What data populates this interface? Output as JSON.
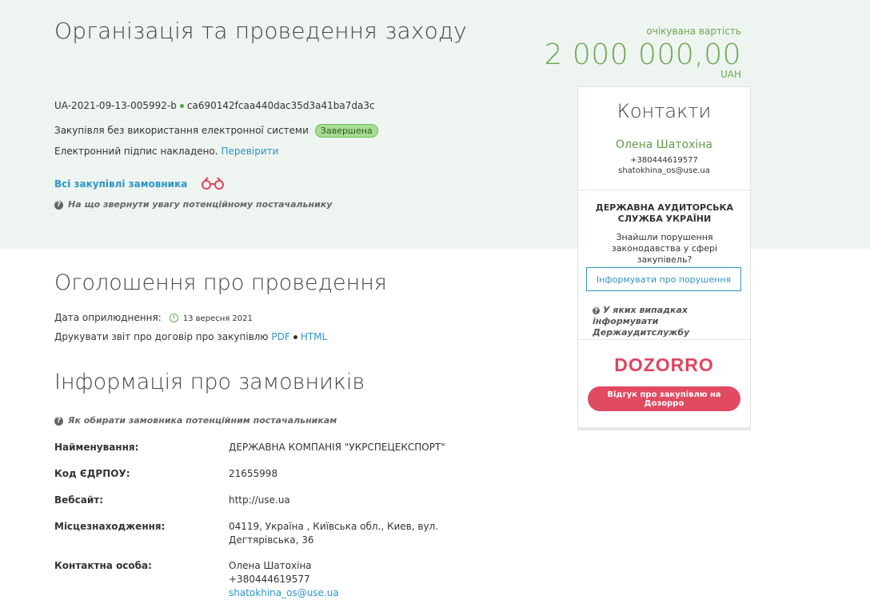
{
  "header": {
    "title": "Організація та проведення заходу",
    "price_label": "очікувана вартість",
    "price": "2 000 000,00",
    "currency": "UAH",
    "tender_id": "UA-2021-09-13-005992-b",
    "tender_hash": "ca690142fcaa440dac35d3a41ba7da3c",
    "procurement_type": "Закупівля без використання електронної системи",
    "status": "Завершена",
    "signature_text": "Електронний підпис накладено.",
    "signature_check": "Перевірити",
    "buyer_link": "Всі закупівлі замовника",
    "hint": "На що звернути увагу потенційному постачальнику"
  },
  "announcement": {
    "title": "Оголошення про проведення",
    "date_label": "Дата оприлюднення:",
    "date_value": "13 вересня 2021",
    "print_label": "Друкувати звіт про договір про закупівлю",
    "pdf": "PDF",
    "html": "HTML"
  },
  "buyer_info": {
    "title": "Інформація про замовників",
    "hint": "Як обирати замовника потенційним постачальникам",
    "rows": [
      {
        "label": "Найменування:",
        "value": "ДЕРЖАВНА КОМПАНІЯ \"УКРСПЕЦЕКСПОРТ\""
      },
      {
        "label": "Код ЄДРПОУ:",
        "value": "21655998"
      },
      {
        "label": "Вебсайт:",
        "value": "http://use.ua"
      },
      {
        "label": "Місцезнаходження:",
        "value_line1": "04119, Україна , Київська обл., Киев, вул.",
        "value_line2": "Дегтярівська, 36"
      },
      {
        "label": "Контактна особа:",
        "name": "Олена Шатохіна",
        "phone": "+380444619577",
        "email": "shatokhina_os@use.ua"
      }
    ]
  },
  "contacts_card": {
    "title": "Контакти",
    "name": "Олена Шатохіна",
    "phone": "+380444619577",
    "email": "shatokhina_os@use.ua",
    "audit_title": "ДЕРЖАВНА АУДИТОРСЬКА СЛУЖБА УКРАЇНИ",
    "audit_text": "Знайшли порушення законодавства у сфері закупівель?",
    "inform_button": "Інформувати про порушення",
    "audit_hint": "У яких випадках інформувати Держаудитслужбу",
    "logo_text": "DOZORRO",
    "review_button": "Відгук про закупівлю на Дозорро"
  },
  "colors": {
    "accent_green": "#6aa852",
    "link_blue": "#2c95c9",
    "dozorro_red": "#e04b62",
    "top_band": "#eef4f0"
  }
}
